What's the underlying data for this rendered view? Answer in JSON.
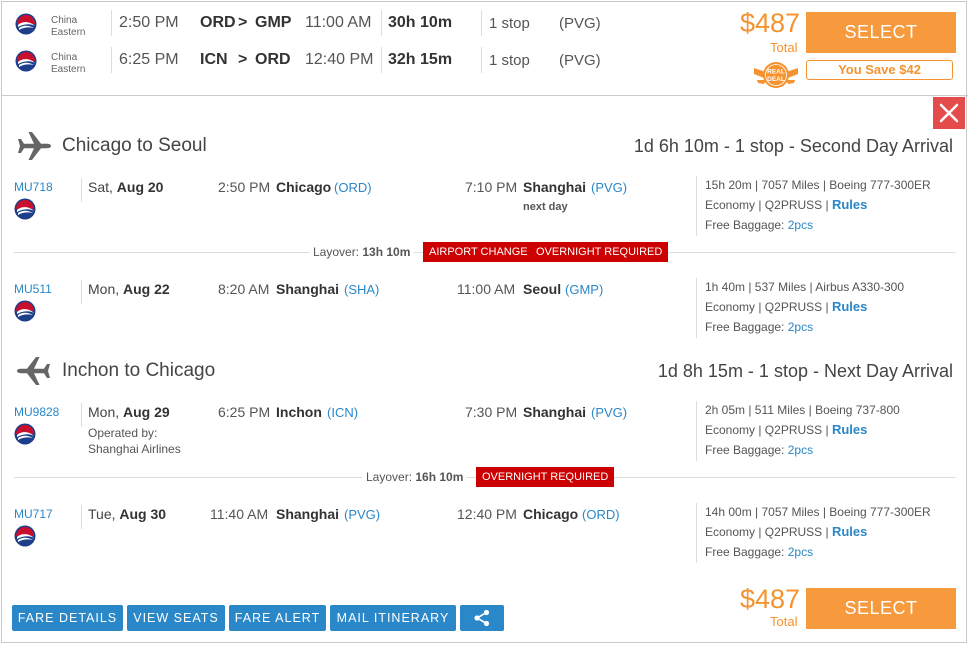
{
  "summary": {
    "rows": [
      {
        "airline": "China Eastern",
        "airline_l1": "China",
        "airline_l2": "Eastern",
        "depart": "2:50 PM",
        "from": "ORD",
        "arrow": ">",
        "to": "GMP",
        "arrive": "11:00 AM",
        "duration": "30h 10m",
        "stops": "1 stop",
        "via": "(PVG)"
      },
      {
        "airline": "China Eastern",
        "airline_l1": "China",
        "airline_l2": "Eastern",
        "depart": "6:25 PM",
        "from": "ICN",
        "arrow": ">",
        "to": "ORD",
        "arrive": "12:40 PM",
        "duration": "32h 15m",
        "stops": "1 stop",
        "via": "(PVG)"
      }
    ],
    "price": "$487",
    "price_label": "Total",
    "select_label": "SELECT",
    "badge_text_1": "REAL",
    "badge_text_2": "DEAL",
    "savings": "You Save $42"
  },
  "sections": [
    {
      "title": "Chicago to Seoul",
      "summary": "1d 6h 10m - 1 stop - Second Day Arrival",
      "segments": [
        {
          "flight": "MU718",
          "date_dow": "Sat,",
          "date": "Aug 20",
          "operated_1": "",
          "operated_2": "",
          "dep_time": "2:50 PM",
          "dep_city": "Chicago",
          "dep_code": "(ORD)",
          "arr_time": "7:10 PM",
          "arr_city": "Shanghai",
          "arr_code": "(PVG)",
          "arr_note": "next day",
          "dur_info": "15h 20m | 7057 Miles | Boeing 777-300ER",
          "cabin": "Economy | Q2PRUSS |",
          "rules": "Rules",
          "baggage_label": "Free Baggage:",
          "baggage": "2pcs"
        },
        {
          "flight": "MU511",
          "date_dow": "Mon,",
          "date": "Aug 22",
          "operated_1": "",
          "operated_2": "",
          "dep_time": "8:20 AM",
          "dep_city": "Shanghai",
          "dep_code": "(SHA)",
          "arr_time": "11:00 AM",
          "arr_city": "Seoul",
          "arr_code": "(GMP)",
          "arr_note": "",
          "dur_info": "1h 40m | 537 Miles | Airbus A330-300",
          "cabin": "Economy | Q2PRUSS |",
          "rules": "Rules",
          "baggage_label": "Free Baggage:",
          "baggage": "2pcs"
        }
      ],
      "layover": {
        "label": "Layover:",
        "duration": "13h 10m",
        "badges": [
          "AIRPORT CHANGE",
          "OVERNIGHT REQUIRED"
        ]
      }
    },
    {
      "title": "Inchon to Chicago",
      "summary": "1d 8h 15m - 1 stop - Next Day Arrival",
      "segments": [
        {
          "flight": "MU9828",
          "date_dow": "Mon,",
          "date": "Aug 29",
          "operated_1": "Operated by:",
          "operated_2": "Shanghai Airlines",
          "dep_time": "6:25 PM",
          "dep_city": "Inchon",
          "dep_code": "(ICN)",
          "arr_time": "7:30 PM",
          "arr_city": "Shanghai",
          "arr_code": "(PVG)",
          "arr_note": "",
          "dur_info": "2h 05m | 511 Miles | Boeing 737-800",
          "cabin": "Economy | Q2PRUSS |",
          "rules": "Rules",
          "baggage_label": "Free Baggage:",
          "baggage": "2pcs"
        },
        {
          "flight": "MU717",
          "date_dow": "Tue,",
          "date": "Aug 30",
          "operated_1": "",
          "operated_2": "",
          "dep_time": "11:40 AM",
          "dep_city": "Shanghai",
          "dep_code": "(PVG)",
          "arr_time": "12:40 PM",
          "arr_city": "Chicago",
          "arr_code": "(ORD)",
          "arr_note": "",
          "dur_info": "14h 00m | 7057 Miles | Boeing 777-300ER",
          "cabin": "Economy | Q2PRUSS |",
          "rules": "Rules",
          "baggage_label": "Free Baggage:",
          "baggage": "2pcs"
        }
      ],
      "layover": {
        "label": "Layover:",
        "duration": "16h 10m",
        "badges": [
          "OVERNIGHT REQUIRED"
        ]
      }
    }
  ],
  "footer": {
    "buttons": [
      "FARE DETAILS",
      "VIEW SEATS",
      "FARE ALERT",
      "MAIL ITINERARY"
    ],
    "price": "$487",
    "price_label": "Total",
    "select_label": "SELECT"
  },
  "icons": {
    "airline_logo": "china-eastern-logo",
    "plane": "airplane-icon",
    "close": "close-icon",
    "share": "share-icon",
    "deal_badge": "real-deal-badge"
  },
  "colors": {
    "accent_orange": "#f79a3e",
    "price_orange": "#f4932f",
    "link_blue": "#2a87c8",
    "badge_red": "#cc0000",
    "close_red": "#e44b4b"
  }
}
